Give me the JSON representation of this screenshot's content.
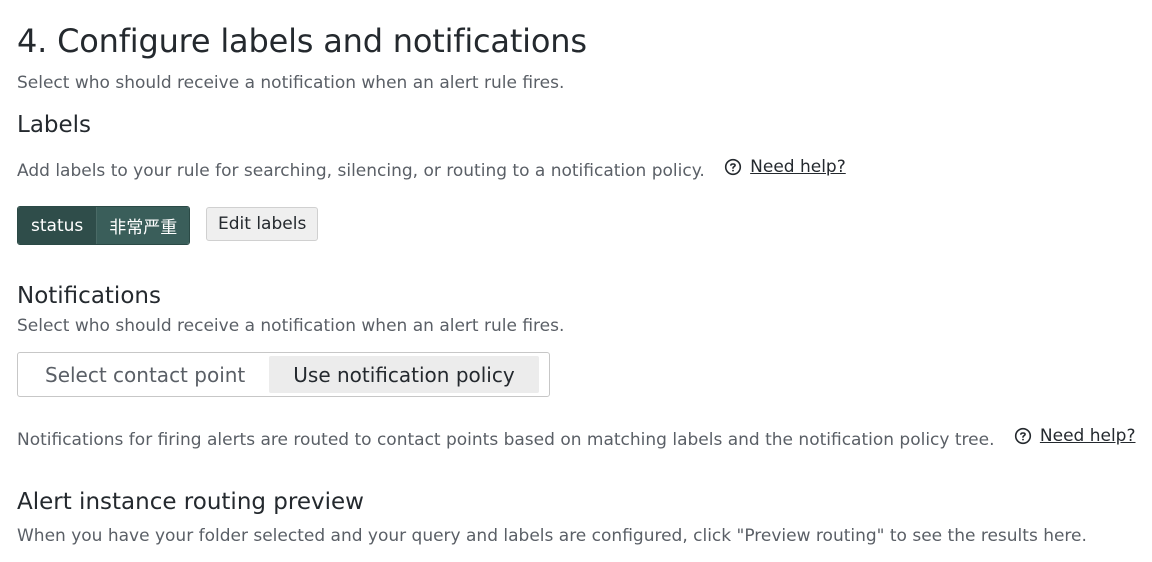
{
  "header": {
    "title": "4. Configure labels and notifications",
    "description": "Select who should receive a notification when an alert rule fires."
  },
  "labels_section": {
    "title": "Labels",
    "description": "Add labels to your rule for searching, silencing, or routing to a notification policy.",
    "help_link": "Need help?",
    "label_key": "status",
    "label_value": "非常严重",
    "edit_button": "Edit labels"
  },
  "notifications_section": {
    "title": "Notifications",
    "description": "Select who should receive a notification when an alert rule fires.",
    "options": [
      {
        "label": "Select contact point",
        "selected": false
      },
      {
        "label": "Use notification policy",
        "selected": true
      }
    ],
    "policy_info": "Notifications for firing alerts are routed to contact points based on matching labels and the notification policy tree.",
    "help_link": "Need help?"
  },
  "routing_preview": {
    "title": "Alert instance routing preview",
    "description": "When you have your folder selected and your query and labels are configured, click \"Preview routing\" to see the results here."
  },
  "colors": {
    "label_chip_key_bg": "#2f4d4a",
    "label_chip_value_bg": "#3a5e5a",
    "active_option_bg": "#ececec"
  },
  "icons": {
    "help": "question-circle-icon"
  }
}
